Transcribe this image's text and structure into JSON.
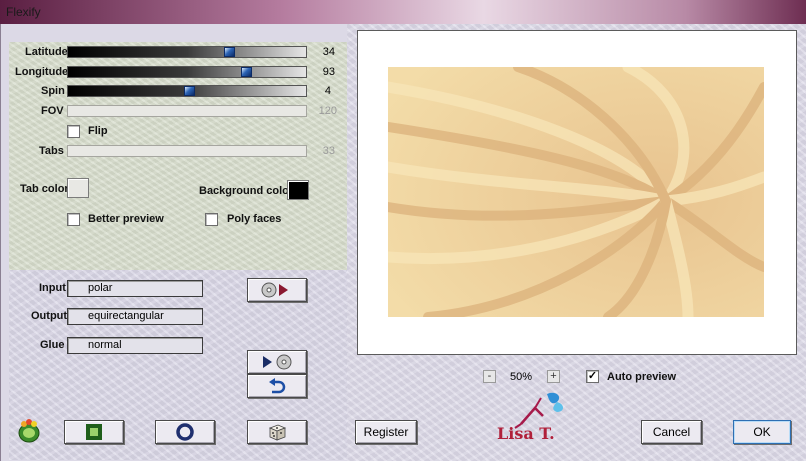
{
  "window": {
    "title": "Flexify"
  },
  "sliders": {
    "latitude": {
      "label": "Latitude",
      "value": "34"
    },
    "longitude": {
      "label": "Longitude",
      "value": "93"
    },
    "spin": {
      "label": "Spin",
      "value": "4"
    },
    "fov": {
      "label": "FOV",
      "value": "120"
    },
    "tabs": {
      "label": "Tabs",
      "value": "33"
    }
  },
  "options": {
    "flip_label": "Flip",
    "tab_color_label": "Tab color",
    "background_color_label": "Background color",
    "better_preview_label": "Better preview",
    "poly_faces_label": "Poly faces",
    "tab_color": "#e8e8e4",
    "background_color": "#000000"
  },
  "mapping": {
    "input_label": "Input",
    "input_value": "polar",
    "output_label": "Output",
    "output_value": "equirectangular",
    "glue_label": "Glue",
    "glue_value": "normal"
  },
  "preview": {
    "zoom_minus": "-",
    "zoom_value": "50%",
    "zoom_plus": "+",
    "auto_preview_label": "Auto preview",
    "auto_preview_checked": "✓"
  },
  "buttons": {
    "register": "Register",
    "cancel": "Cancel",
    "ok": "OK"
  },
  "logo": {
    "text": "Lisa T."
  },
  "icons": {
    "app": "flexify-logo-icon",
    "frame": "square-frame-icon",
    "ring": "ring-icon",
    "dice": "dice-icon",
    "undo": "undo-icon",
    "disc_arrow": "disc-arrow-icon",
    "arrow_disc": "arrow-disc-icon"
  }
}
